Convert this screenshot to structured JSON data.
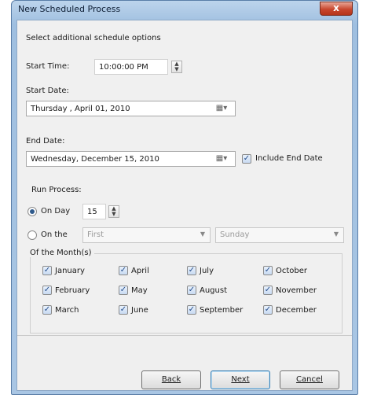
{
  "window": {
    "title": "New Scheduled Process",
    "close_glyph": "x"
  },
  "options_heading": "Select additional schedule options",
  "start_time": {
    "label": "Start Time:",
    "value": "10:00:00 PM"
  },
  "start_date": {
    "label": "Start Date:",
    "value": "Thursday ,    April    01, 2010"
  },
  "end_date": {
    "label": "End Date:",
    "value": "Wednesday, December  15, 2010",
    "include_label": "Include End Date",
    "include_checked": true
  },
  "run_process": {
    "label": "Run Process:",
    "on_day_label": "On Day",
    "on_day_value": "15",
    "on_the_label": "On the",
    "ordinal_value": "First",
    "weekday_value": "Sunday",
    "selected": "on_day"
  },
  "months": {
    "group_label": "Of the Month(s)",
    "items": [
      "January",
      "February",
      "March",
      "April",
      "May",
      "June",
      "July",
      "August",
      "September",
      "October",
      "November",
      "December"
    ]
  },
  "buttons": {
    "back": "Back",
    "next": "Next",
    "cancel": "Cancel"
  },
  "icons": {
    "calendar": "calendar-dropdown-icon",
    "spinner": "spinner-arrows-icon"
  }
}
